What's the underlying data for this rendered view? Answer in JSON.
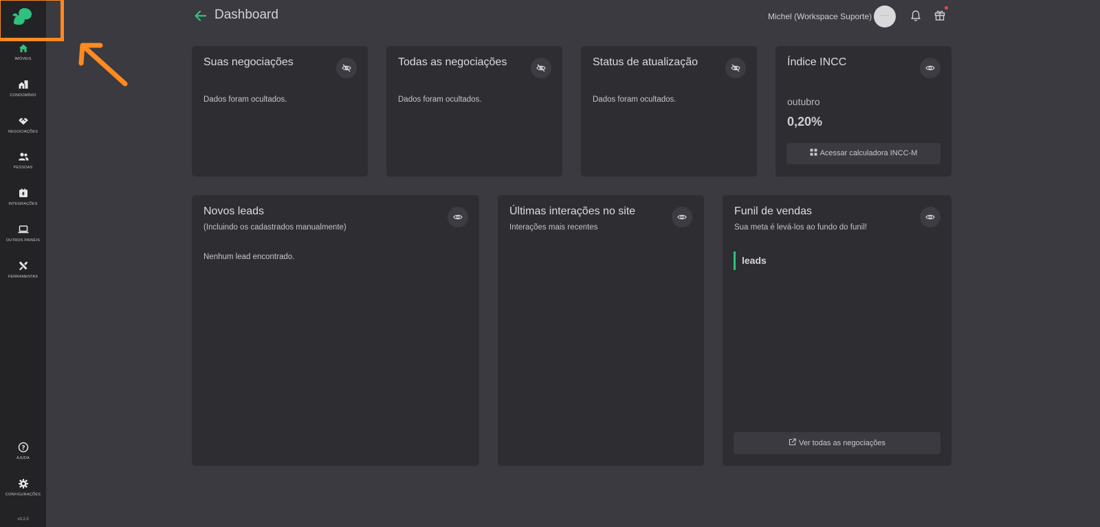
{
  "brand": {
    "accent": "#2ec27e",
    "annotation": "#ff8a1f",
    "notification_dot": "#e8455d"
  },
  "sidebar": {
    "items": [
      {
        "label": "IMÓVEIS",
        "icon": "home-icon"
      },
      {
        "label": "CONDOMÍNIO",
        "icon": "building-icon"
      },
      {
        "label": "NEGOCIAÇÕES",
        "icon": "handshake-icon"
      },
      {
        "label": "PESSOAS",
        "icon": "people-icon"
      },
      {
        "label": "INTEGRAÇÕES",
        "icon": "integration-icon"
      },
      {
        "label": "OUTROS PAINÉIS",
        "icon": "laptop-icon"
      },
      {
        "label": "FERRAMENTAS",
        "icon": "tools-icon"
      }
    ],
    "bottom": [
      {
        "label": "AJUDA",
        "icon": "help-icon"
      },
      {
        "label": "CONFIGURAÇÕES",
        "icon": "gear-icon"
      }
    ],
    "version": "v3.2.0"
  },
  "header": {
    "title": "Dashboard",
    "user": "Michel (Workspace Suporte)"
  },
  "cards_top": [
    {
      "title": "Suas negociações",
      "message": "Dados foram ocultados."
    },
    {
      "title": "Todas as negociações",
      "message": "Dados foram ocultados."
    },
    {
      "title": "Status de atualização",
      "message": "Dados foram ocultados."
    }
  ],
  "incc": {
    "title": "Índice INCC",
    "month": "outubro",
    "value": "0,20%",
    "button": "Acessar calculadora INCC-M"
  },
  "leads": {
    "title": "Novos leads",
    "subtitle": "(Incluindo os cadastrados manualmente)",
    "empty": "Nenhum lead encontrado."
  },
  "interactions": {
    "title": "Últimas interações no site",
    "subtitle": "Interações mais recentes"
  },
  "funnel": {
    "title": "Funil de vendas",
    "subtitle": "Sua meta é levá-los ao fundo do funil!",
    "stage": "leads",
    "button": "Ver todas as negociações"
  }
}
